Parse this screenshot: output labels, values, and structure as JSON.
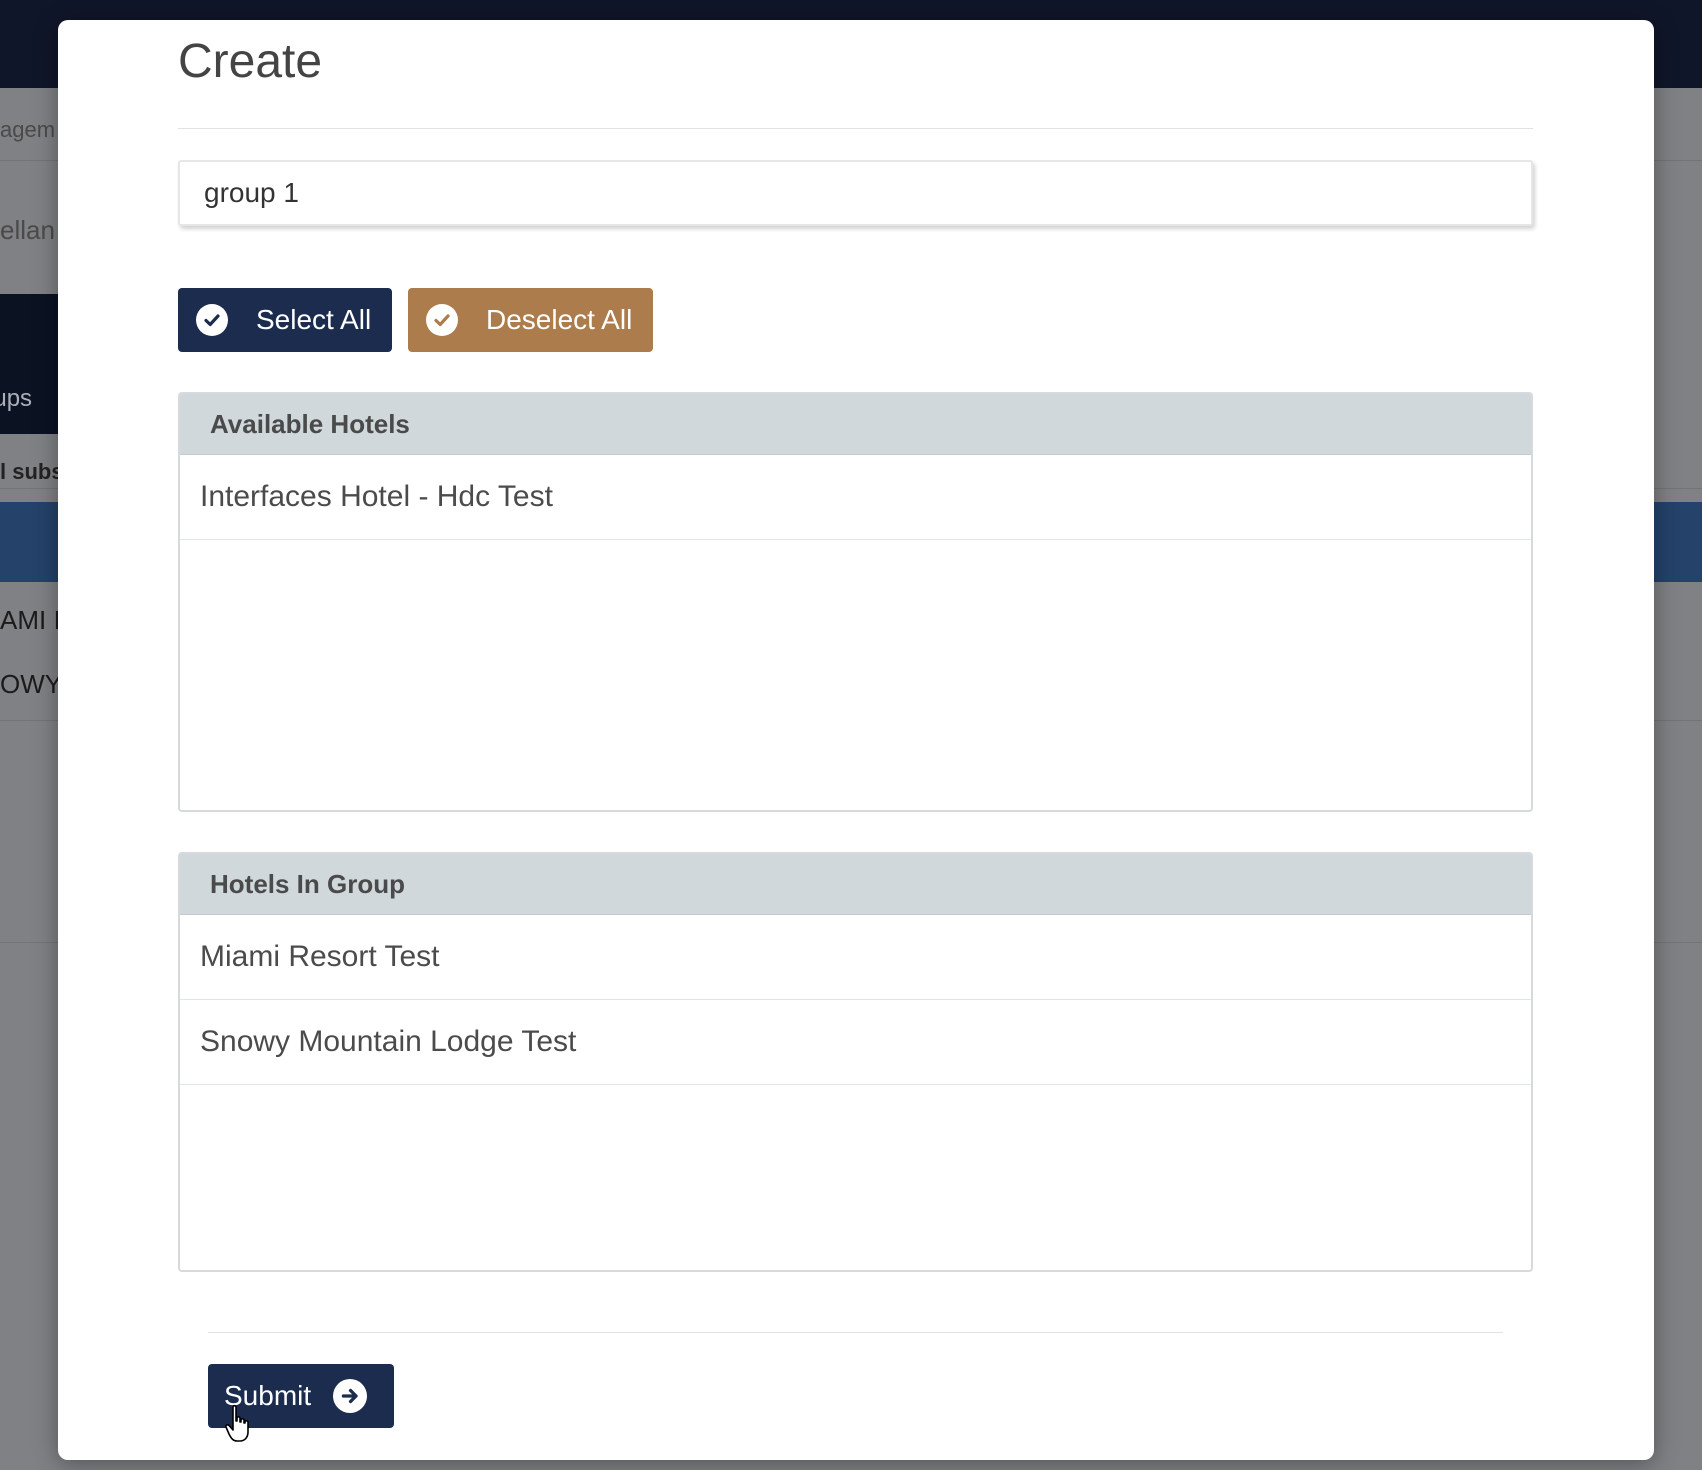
{
  "background": {
    "logo_text": "",
    "fragments": [
      "agem",
      "ellan",
      "oups",
      "l subs",
      "AMI I",
      "OWY"
    ]
  },
  "modal": {
    "title": "Create",
    "name_input": {
      "value": "group 1",
      "placeholder": ""
    },
    "buttons": {
      "select_all": "Select All",
      "deselect_all": "Deselect All",
      "submit": "Submit"
    },
    "available_hotels": {
      "header": "Available Hotels",
      "items": [
        "Interfaces Hotel - Hdc Test"
      ]
    },
    "hotels_in_group": {
      "header": "Hotels In Group",
      "items": [
        "Miami Resort Test",
        "Snowy Mountain Lodge Test"
      ]
    }
  },
  "colors": {
    "primary": "#1b2c4e",
    "secondary": "#ad7c4c",
    "panel_header": "#d0d8dc",
    "overlay": "#7f8184"
  },
  "icons": {
    "select_all": "check-circle-icon",
    "deselect_all": "check-circle-icon",
    "submit": "arrow-right-circle-icon",
    "cursor": "hand-pointer-icon"
  }
}
